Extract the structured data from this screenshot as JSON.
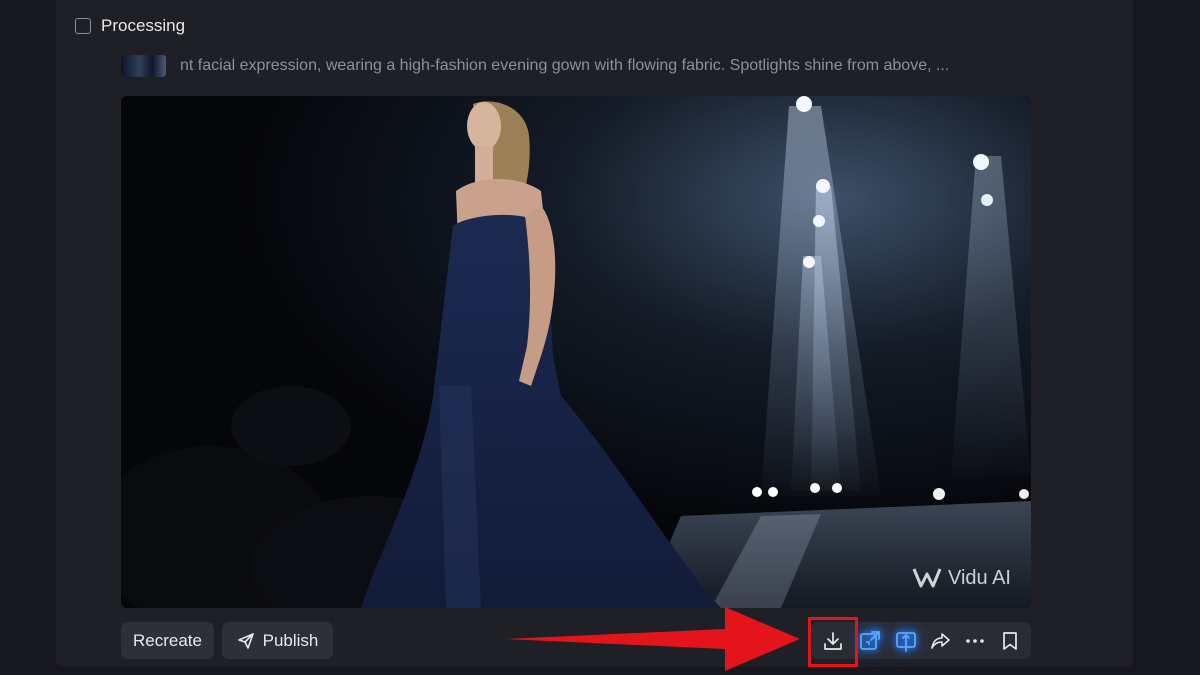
{
  "header": {
    "status_label": "Processing"
  },
  "prompt": {
    "text": "nt facial expression, wearing a high-fashion evening gown with flowing fabric. Spotlights shine from above, ..."
  },
  "video": {
    "watermark": "Vidu AI"
  },
  "toolbar": {
    "recreate_label": "Recreate",
    "publish_label": "Publish",
    "actions": [
      "download-icon",
      "extend-icon",
      "upscale-icon",
      "share-icon",
      "more-icon",
      "bookmark-icon"
    ]
  },
  "annotation": {
    "color": "#e3141b",
    "target": "download-icon"
  },
  "colors": {
    "accent_glow": "#2f8cff",
    "button_bg": "#2e3038",
    "panel_bg": "#1f2026"
  }
}
